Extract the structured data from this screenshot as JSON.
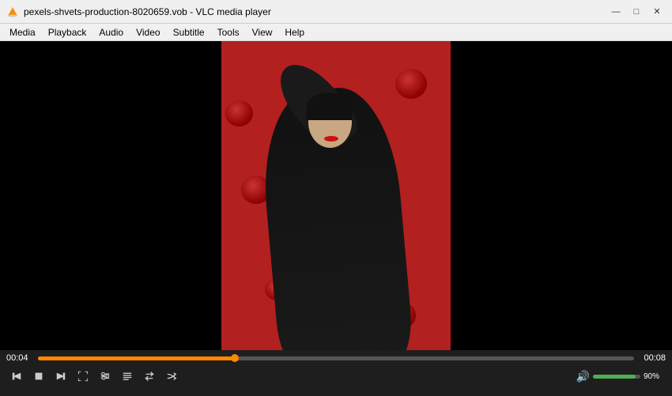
{
  "titlebar": {
    "title": "pexels-shvets-production-8020659.vob - VLC media player",
    "minimize": "—",
    "maximize": "□",
    "close": "✕"
  },
  "menubar": {
    "items": [
      "Media",
      "Playback",
      "Audio",
      "Video",
      "Subtitle",
      "Tools",
      "View",
      "Help"
    ]
  },
  "controls": {
    "time_current": "00:04",
    "time_total": "00:08",
    "volume_percent": "90%",
    "progress_percent": 33,
    "volume_percent_num": 90
  }
}
